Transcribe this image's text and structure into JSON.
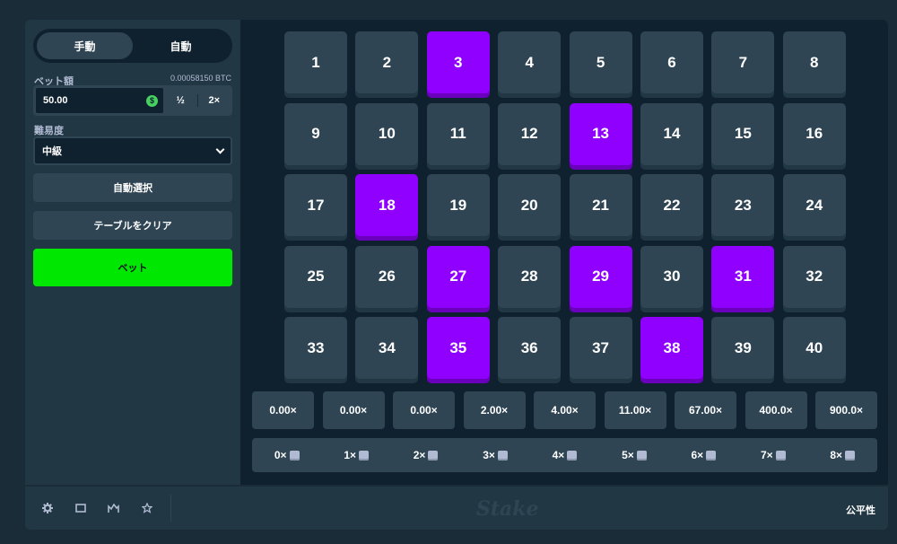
{
  "sidebar": {
    "modes": [
      "手動",
      "自動"
    ],
    "active_mode": 0,
    "bet_amount_label": "ベット額",
    "bet_amount_btc": "0.00058150 BTC",
    "bet_value": "50.00",
    "half_label": "½",
    "double_label": "2×",
    "difficulty_label": "難易度",
    "difficulty_value": "中級",
    "auto_pick_label": "自動選択",
    "clear_label": "テーブルをクリア",
    "bet_label": "ベット"
  },
  "board": {
    "numbers": [
      "1",
      "2",
      "3",
      "4",
      "5",
      "6",
      "7",
      "8",
      "9",
      "10",
      "11",
      "12",
      "13",
      "14",
      "15",
      "16",
      "17",
      "18",
      "19",
      "20",
      "21",
      "22",
      "23",
      "24",
      "25",
      "26",
      "27",
      "28",
      "29",
      "30",
      "31",
      "32",
      "33",
      "34",
      "35",
      "36",
      "37",
      "38",
      "39",
      "40"
    ],
    "selected": [
      3,
      13,
      18,
      27,
      29,
      31,
      35,
      38
    ],
    "multipliers": [
      "0.00×",
      "0.00×",
      "0.00×",
      "2.00×",
      "4.00×",
      "11.00×",
      "67.00×",
      "400.0×",
      "900.0×"
    ],
    "hits": [
      "0×",
      "1×",
      "2×",
      "3×",
      "4×",
      "5×",
      "6×",
      "7×",
      "8×"
    ]
  },
  "footer": {
    "logo": "Stake",
    "fairness_label": "公平性"
  },
  "colors": {
    "selected_tile": "#9000ff",
    "bet_button": "#00e701",
    "tile": "#2f4553"
  }
}
